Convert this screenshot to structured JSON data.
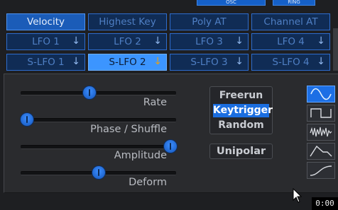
{
  "top_tabs": [
    "OSC",
    "RING"
  ],
  "mod_buttons": [
    [
      "Velocity",
      "Highest Key",
      "Poly AT",
      "Channel AT"
    ],
    [
      "LFO 1",
      "LFO 2",
      "LFO 3",
      "LFO 4"
    ],
    [
      "S-LFO 1",
      "S-LFO 2",
      "S-LFO 3",
      "S-LFO 4"
    ]
  ],
  "sliders": [
    {
      "label": "Rate",
      "value": 0.4
    },
    {
      "label": "Phase / Shuffle",
      "value": 0.0
    },
    {
      "label": "Amplitude",
      "value": 1.0
    },
    {
      "label": "Deform",
      "value": 0.5
    }
  ],
  "trigger_modes": [
    "Freerun",
    "Keytrigger",
    "Random"
  ],
  "selected_trigger_mode": "Keytrigger",
  "unipolar_label": "Unipolar",
  "waveforms": [
    "sine-wave-icon",
    "square-wave-icon",
    "noise-wave-icon",
    "envelope-shape-icon",
    "ramp-shape-icon"
  ],
  "selected_waveform": "sine-wave-icon",
  "time_readout": "0:00",
  "colors": {
    "accent": "#1b6ee0",
    "selected": "#3c95ff",
    "arrow_highlight": "#e0a020"
  }
}
